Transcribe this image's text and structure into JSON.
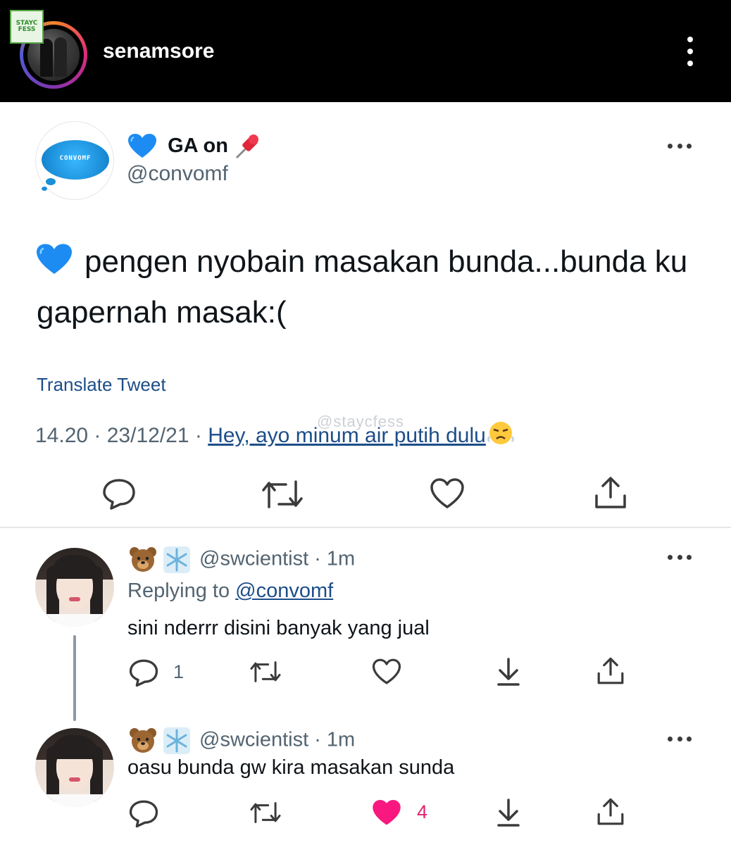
{
  "instagram": {
    "logo_top": "STAYC",
    "logo_bottom": "FESS",
    "username": "senamsore"
  },
  "tweet": {
    "avatar_label": "CONVOMF",
    "display_name": "GA on",
    "handle": "@convomf",
    "text": "pengen nyobain masakan bunda...bunda ku gapernah masak:(",
    "translate_label": "Translate Tweet",
    "time": "14.20",
    "date": "23/12/21",
    "source": "Hey, ayo minum air putih dulu",
    "watermark": "@staycfess"
  },
  "replies": [
    {
      "handle": "@swcientist",
      "time": "1m",
      "replying_label": "Replying to",
      "replying_handle": "@convomf",
      "text": "sini nderrr disini banyak yang jual",
      "reply_count": "1"
    },
    {
      "handle": "@swcientist",
      "time": "1m",
      "text": "oasu bunda gw kira masakan sunda",
      "like_count": "4",
      "liked": true
    }
  ],
  "colors": {
    "instagram_bar": "#000000",
    "link": "#1d4e89",
    "secondary_text": "#536471",
    "like_active": "#f91880",
    "heart_blue": "#1d8cf2"
  },
  "icons": [
    "more-vertical-icon",
    "more-horizontal-icon",
    "blue-heart-emoji",
    "pushpin-emoji",
    "bear-emoji",
    "snowflake-emoji",
    "huffing-face-emoji",
    "reply-icon",
    "retweet-icon",
    "like-icon",
    "share-icon",
    "download-icon"
  ]
}
